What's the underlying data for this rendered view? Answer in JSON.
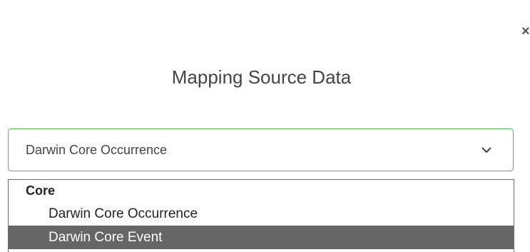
{
  "dialog": {
    "close_glyph": "×",
    "title": "Mapping Source Data"
  },
  "select": {
    "value": "Darwin Core Occurrence",
    "accent_color": "#5cb85c"
  },
  "dropdown": {
    "group_label": "Core",
    "options": [
      {
        "label": "Darwin Core Occurrence"
      },
      {
        "label": "Darwin Core Event",
        "highlighted": true
      }
    ],
    "highlight_color": "#666666"
  }
}
